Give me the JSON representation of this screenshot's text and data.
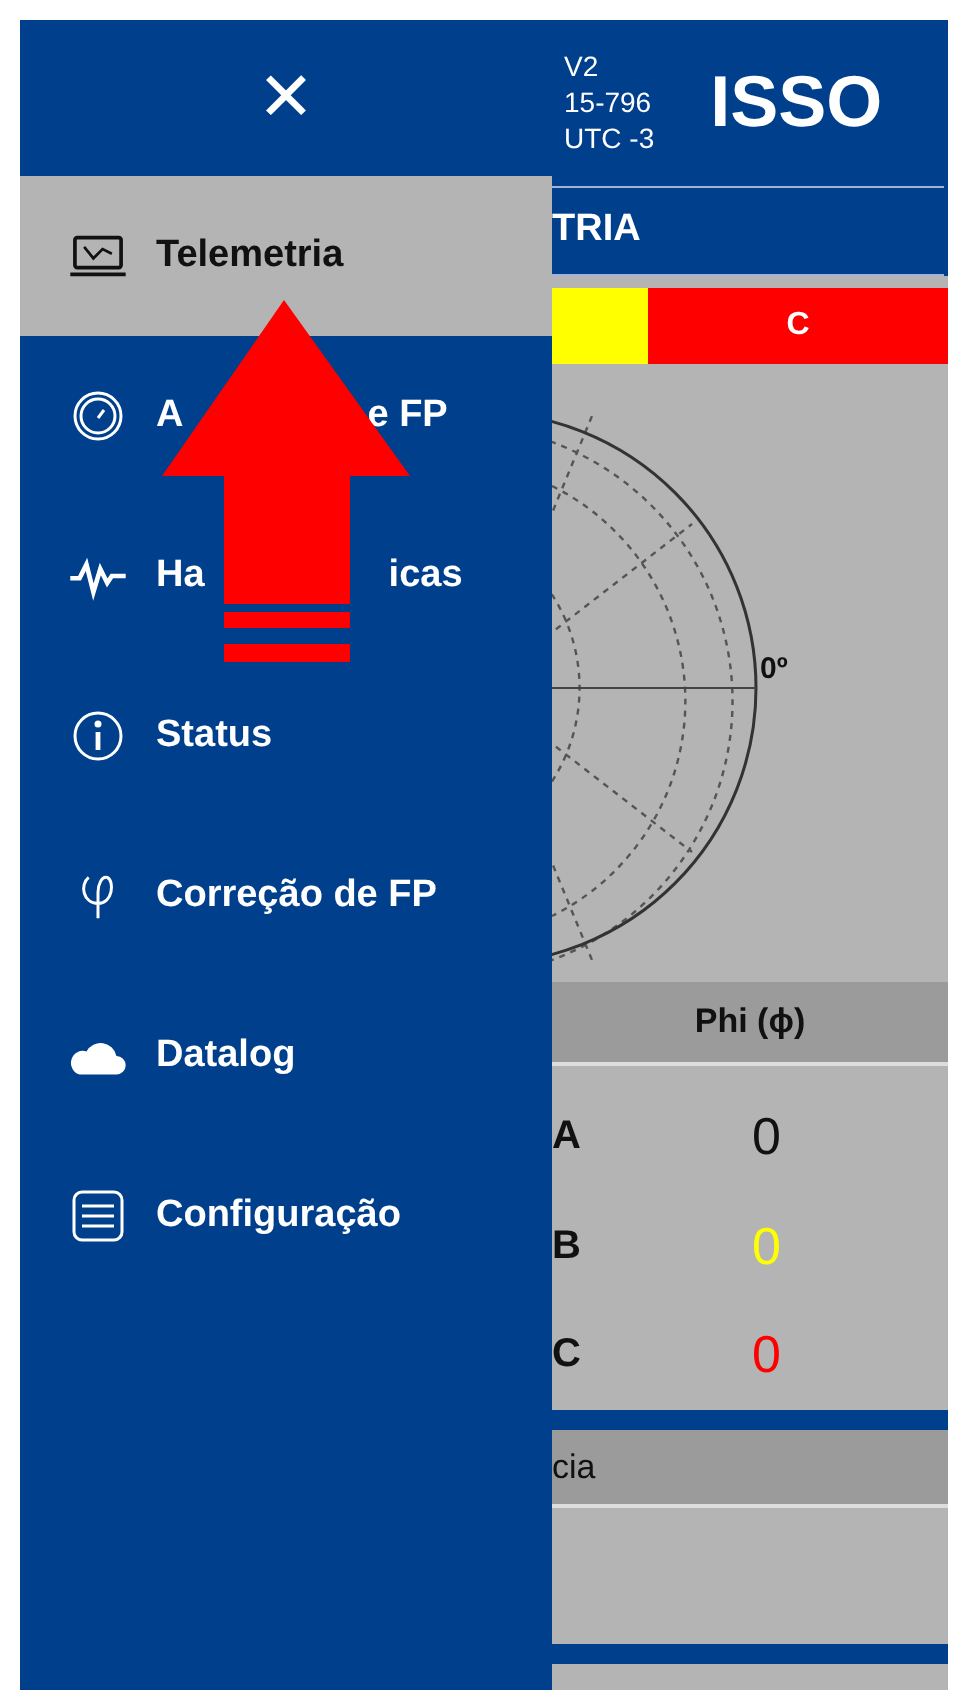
{
  "menu": {
    "close": "✕",
    "items": [
      {
        "kind": "telemetry",
        "label": "Telemetria",
        "selected": true
      },
      {
        "kind": "gauge",
        "label_parts": [
          "A",
          "e FP"
        ],
        "selected": false
      },
      {
        "kind": "pulse",
        "label_parts": [
          "Ha",
          "icas"
        ],
        "selected": false
      },
      {
        "kind": "info",
        "label": "Status",
        "selected": false
      },
      {
        "kind": "phi",
        "label": "Correção de FP",
        "selected": false
      },
      {
        "kind": "cloud",
        "label": "Datalog",
        "selected": false
      },
      {
        "kind": "sliders",
        "label": "Configuração",
        "selected": false
      }
    ]
  },
  "header": {
    "info_lines": [
      "V2",
      "15-796",
      "UTC -3"
    ],
    "logo": "ISSO",
    "page_title": "TRIA"
  },
  "phase_bar": [
    {
      "color": "#ffff00"
    },
    {
      "label": "C",
      "color": "#ff0000"
    }
  ],
  "polar": {
    "angle_label": "0º"
  },
  "phi_table": {
    "heading": "Phi (ϕ)",
    "rows": [
      {
        "phase": "A",
        "value": "0",
        "color": "#111111"
      },
      {
        "phase": "B",
        "value": "0",
        "color": "#ffff00"
      },
      {
        "phase": "C",
        "value": "0",
        "color": "#ff0000"
      }
    ]
  },
  "next_section": {
    "heading": "cia"
  }
}
